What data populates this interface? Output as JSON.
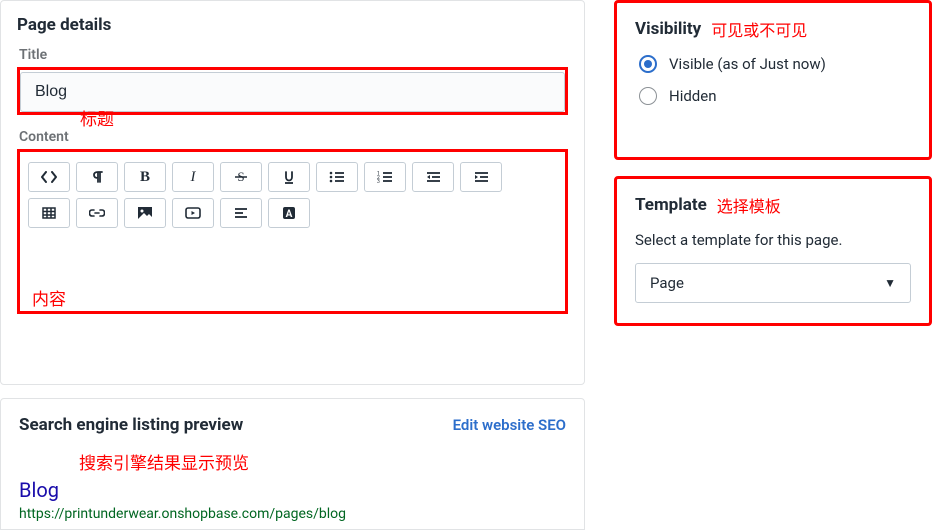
{
  "main": {
    "section_title": "Page details",
    "title_label": "Title",
    "title_value": "Blog",
    "title_annotation": "标题",
    "content_label": "Content",
    "content_annotation": "内容"
  },
  "visibility": {
    "heading": "Visibility",
    "annotation": "可见或不可見",
    "option_visible": "Visible (as of Just now)",
    "option_hidden": "Hidden",
    "selected": "visible"
  },
  "template": {
    "heading": "Template",
    "annotation": "选择模板",
    "description": "Select a template for this page.",
    "selected_option": "Page"
  },
  "seo": {
    "heading": "Search engine listing preview",
    "edit_link": "Edit website SEO",
    "annotation": "搜索引擎结果显示预览",
    "page_title": "Blog",
    "url": "https://printunderwear.onshopbase.com/pages/blog"
  },
  "visibility_heading_fix": "可见或不可见"
}
